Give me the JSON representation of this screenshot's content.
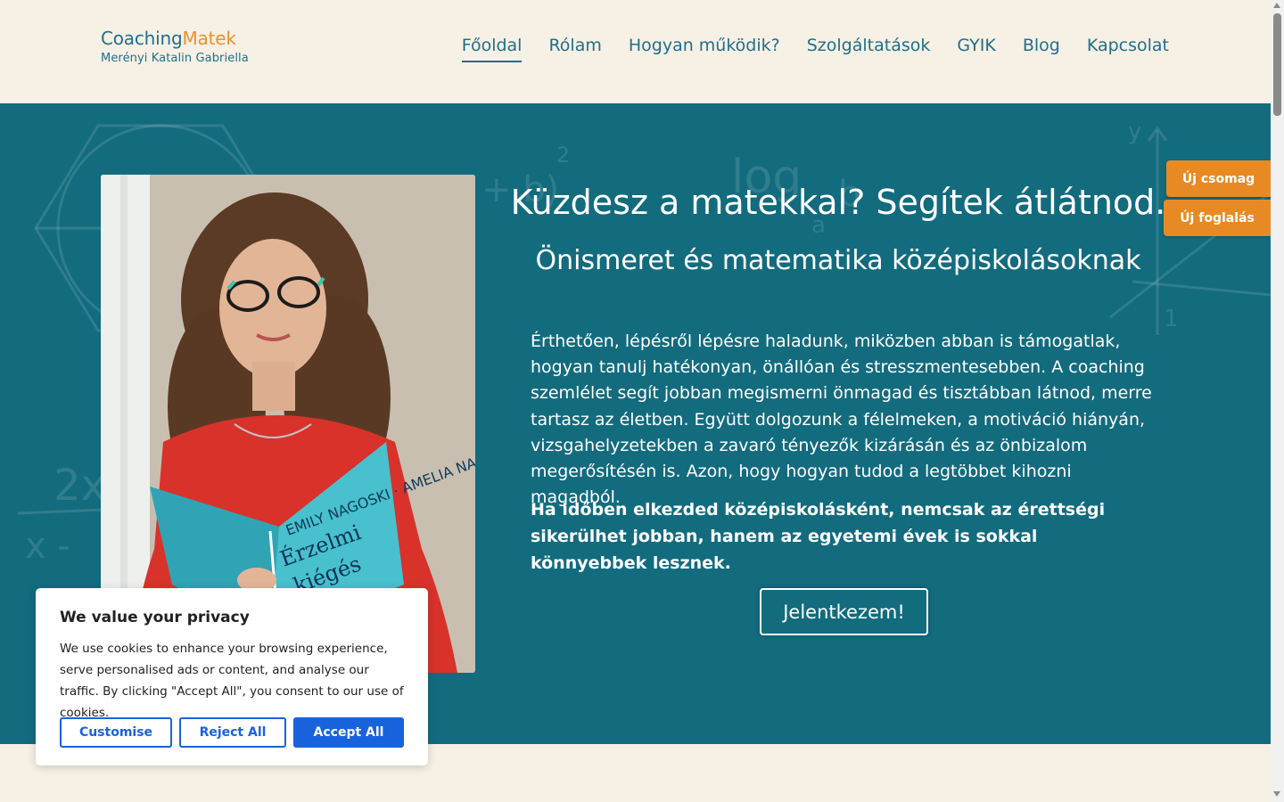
{
  "logo": {
    "part1": "Coaching",
    "part2": "Matek",
    "subtitle": "Merényi Katalin Gabriella"
  },
  "nav": {
    "items": [
      "Főoldal",
      "Rólam",
      "Hogyan működik?",
      "Szolgáltatások",
      "GYIK",
      "Blog",
      "Kapcsolat"
    ],
    "active": "Főoldal"
  },
  "hero": {
    "title": "Küzdesz a matekkal? Segítek átlátnod.",
    "subtitle": "Önismeret és matematika középiskolásoknak",
    "paragraph": "Érthetően, lépésről lépésre haladunk, miközben abban is támogatlak, hogyan tanulj hatékonyan, önállóan és stresszmentesebben. A coaching szemlélet segít jobban megismerni önmagad és tisztábban látnod, merre tartasz az életben. Együtt dolgozunk a félelmeken, a motiváció hiányán, vizsgahelyzetekben a zavaró tényezők kizárásán és az önbizalom megerősítésén is. Azon, hogy hogyan tudod a legtöbbet kihozni magadból.",
    "bold_paragraph": "Ha időben elkezded középiskolásként, nemcsak az érettségi sikerülhet jobban, hanem az egyetemi évek is sokkal könnyebbek lesznek.",
    "cta": "Jelentkezem!",
    "book_title_1": "Érzelmi",
    "book_title_2": "kiégés",
    "book_author": "EMILY NAGOSKI · AMELIA NAGOSKI"
  },
  "side_buttons": {
    "new_package": "Új csomag",
    "new_booking": "Új foglalás"
  },
  "cookie": {
    "title": "We value your privacy",
    "text": "We use cookies to enhance your browsing experience, serve personalised ads or content, and analyse our traffic. By clicking \"Accept All\", you consent to our use of cookies.",
    "customise": "Customise",
    "reject": "Reject All",
    "accept": "Accept All"
  },
  "colors": {
    "teal": "#136b7e",
    "cream": "#f7f0e5",
    "orange": "#e88a23",
    "cookie_blue": "#1863dc",
    "text_teal": "#1f6f8b"
  }
}
